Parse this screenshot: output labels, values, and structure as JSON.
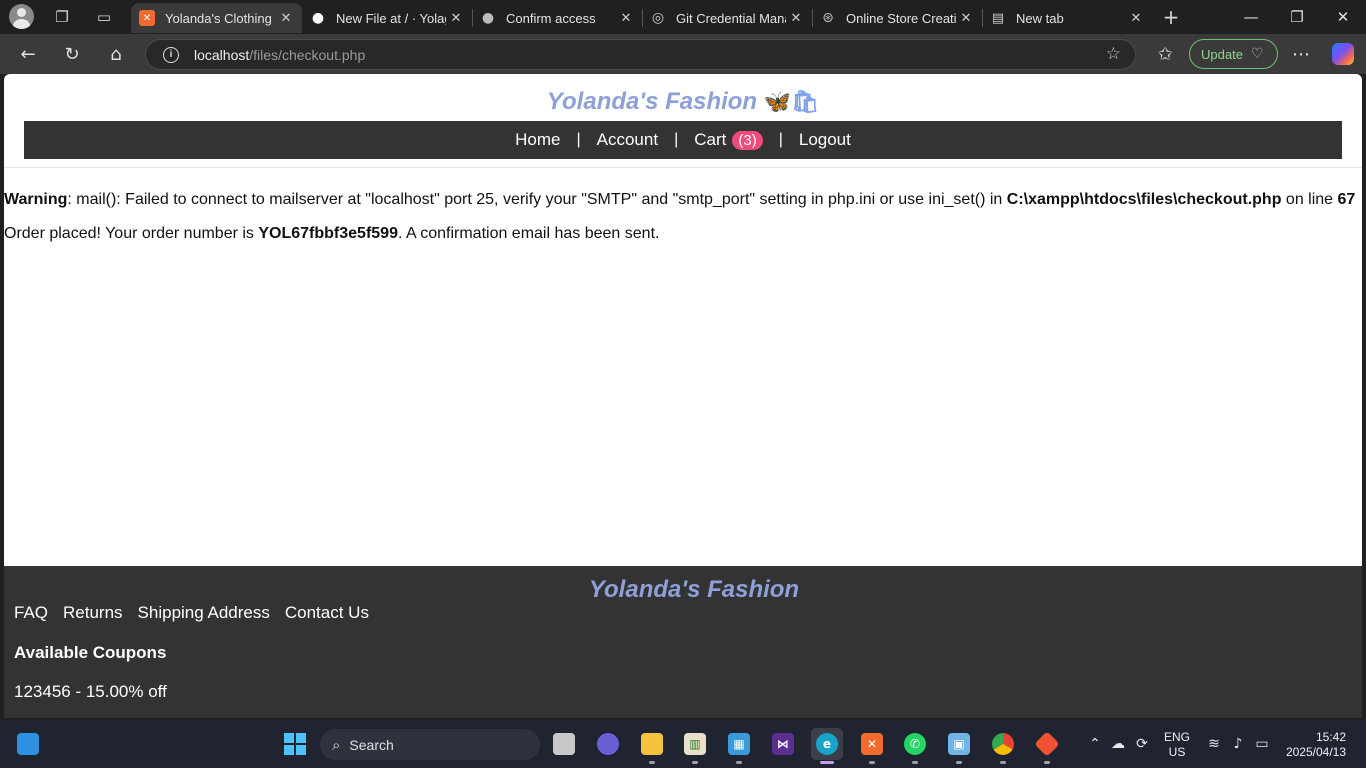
{
  "browser": {
    "tabs": [
      {
        "title": "Yolanda's Clothing",
        "active": true
      },
      {
        "title": "New File at / · Yolaga",
        "active": false
      },
      {
        "title": "Confirm access",
        "active": false
      },
      {
        "title": "Git Credential Manag",
        "active": false
      },
      {
        "title": "Online Store Creatio",
        "active": false
      },
      {
        "title": "New tab",
        "active": false
      }
    ],
    "url_host": "localhost",
    "url_path": "/files/checkout.php",
    "update_label": "Update",
    "icons": {
      "back": "back-arrow-icon",
      "reload": "reload-icon",
      "home": "home-icon",
      "favorites": "star-icon",
      "more": "more-dots-icon"
    }
  },
  "site": {
    "title": "Yolanda's Fashion",
    "title_emoji": "🦋🛍",
    "nav": {
      "home": "Home",
      "account": "Account",
      "cart": "Cart",
      "cart_count": "(3)",
      "logout": "Logout",
      "separator": "|"
    }
  },
  "warning": {
    "label": "Warning",
    "message": ": mail(): Failed to connect to mailserver at \"localhost\" port 25, verify your \"SMTP\" and \"smtp_port\" setting in php.ini or use ini_set() in ",
    "file": "C:\\xampp\\htdocs\\files\\checkout.php",
    "on_line": " on line ",
    "line": "67"
  },
  "confirmation": {
    "prefix": "Order placed! Your order number is ",
    "order_number": "YOL67fbbf3e5f599",
    "suffix": ". A confirmation email has been sent."
  },
  "footer": {
    "title": "Yolanda's Fashion",
    "links": [
      "FAQ",
      "Returns",
      "Shipping Address",
      "Contact Us"
    ],
    "coupons_title": "Available Coupons",
    "coupon": "123456 - 15.00% off"
  },
  "taskbar": {
    "search_label": "Search",
    "lang_line1": "ENG",
    "lang_line2": "US",
    "time": "15:42",
    "date": "2025/04/13"
  },
  "colors": {
    "brand": "#8da0d8",
    "nav_bg": "#333333",
    "cart_badge": "#f04b7a"
  }
}
